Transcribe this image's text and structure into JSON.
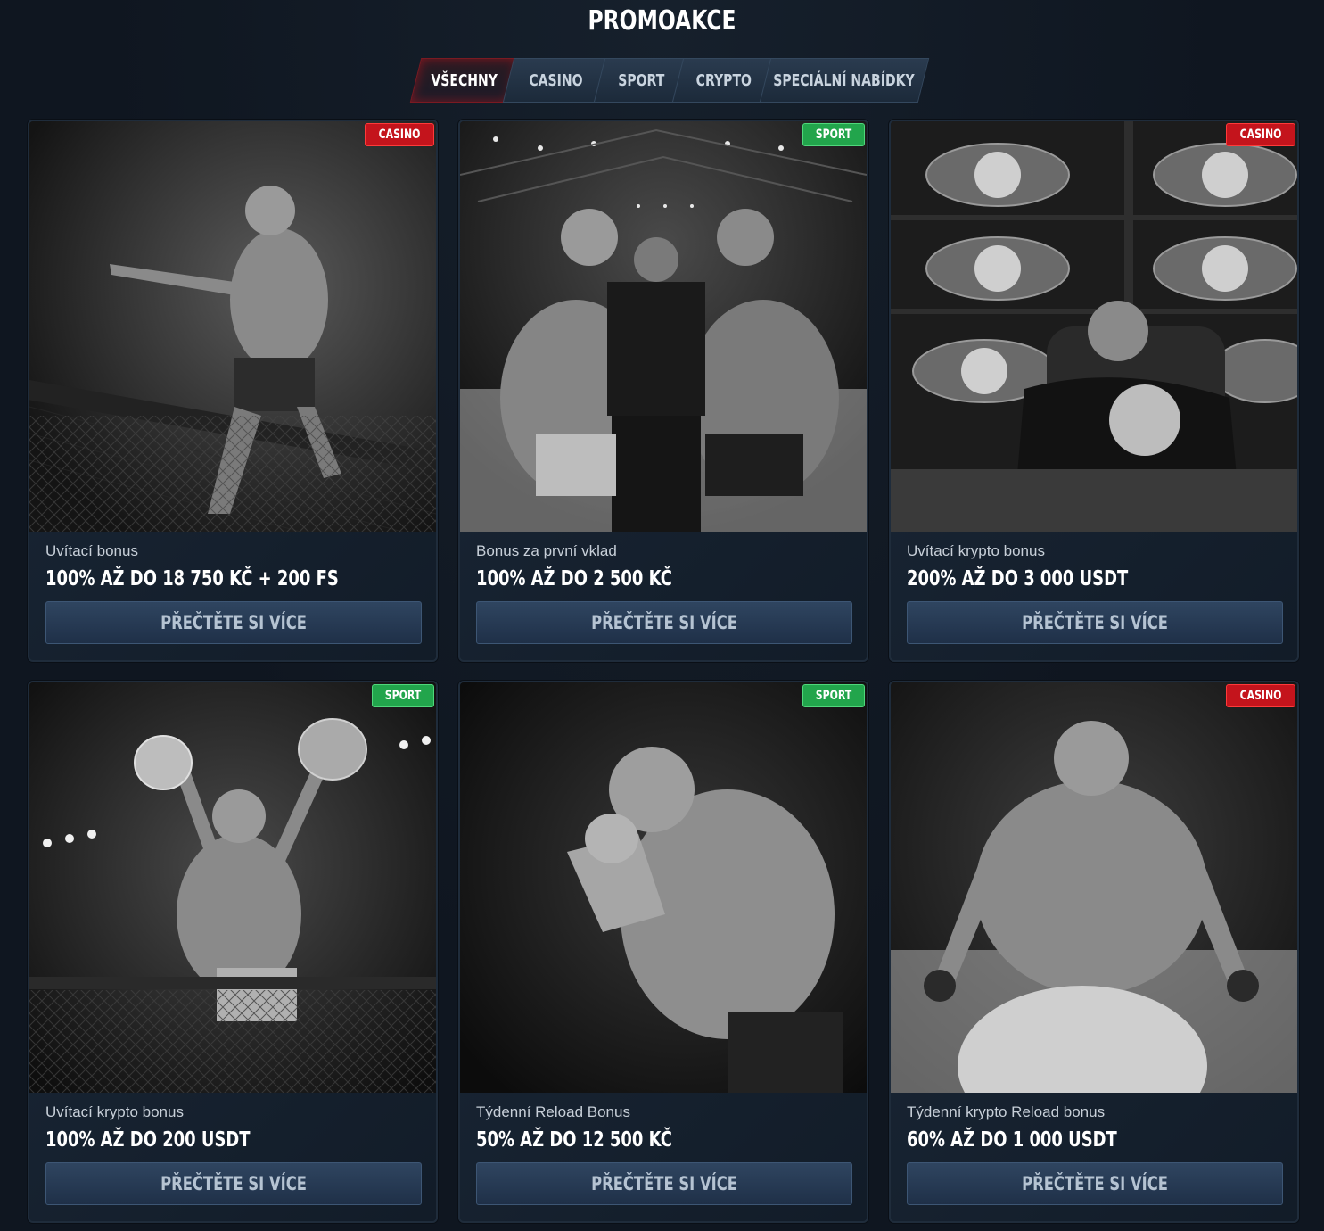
{
  "page": {
    "title": "PROMOAKCE"
  },
  "tabs": [
    {
      "label": "VŠECHNY",
      "active": true
    },
    {
      "label": "CASINO",
      "active": false
    },
    {
      "label": "SPORT",
      "active": false
    },
    {
      "label": "CRYPTO",
      "active": false
    },
    {
      "label": "SPECIÁLNÍ NABÍDKY",
      "active": false
    }
  ],
  "colors": {
    "background": "#0f1620",
    "badge_casino": "#c4141c",
    "badge_sport": "#22a54c",
    "button": "#2f4560",
    "tab_active_glow": "#c8141e"
  },
  "promos": [
    {
      "badge": "CASINO",
      "badge_type": "casino",
      "subtitle": "Uvítací bonus",
      "headline": "100% AŽ DO 18 750 KČ + 200 FS",
      "button_label": "PŘEČTĚTE SI VÍCE",
      "image": "fighter-on-cage-pointing"
    },
    {
      "badge": "SPORT",
      "badge_type": "sport",
      "subtitle": "Bonus za první vklad",
      "headline": "100% AŽ DO 2 500 KČ",
      "button_label": "PŘEČTĚTE SI VÍCE",
      "image": "faceoff-with-referee"
    },
    {
      "badge": "CASINO",
      "badge_type": "casino",
      "subtitle": "Uvítací krypto bonus",
      "headline": "200% AŽ DO 3 000 USDT",
      "button_label": "PŘEČTĚTE SI VÍCE",
      "image": "man-with-crypto-belts"
    },
    {
      "badge": "SPORT",
      "badge_type": "sport",
      "subtitle": "Uvítací krypto bonus",
      "headline": "100% AŽ DO 200 USDT",
      "button_label": "PŘEČTĚTE SI VÍCE",
      "image": "champion-raising-belts"
    },
    {
      "badge": "SPORT",
      "badge_type": "sport",
      "subtitle": "Týdenní Reload Bonus",
      "headline": "50% AŽ DO 12 500 KČ",
      "button_label": "PŘEČTĚTE SI VÍCE",
      "image": "fighter-hands-clasped"
    },
    {
      "badge": "CASINO",
      "badge_type": "casino",
      "subtitle": "Týdenní krypto Reload bonus",
      "headline": "60% AŽ DO 1 000 USDT",
      "button_label": "PŘEČTĚTE SI VÍCE",
      "image": "fighter-yelling"
    }
  ]
}
